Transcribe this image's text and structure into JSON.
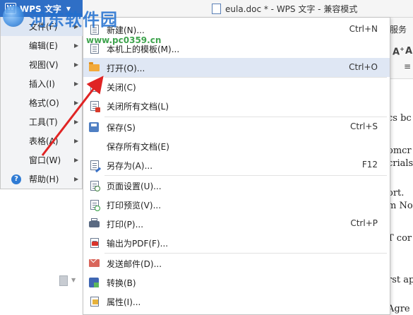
{
  "titlebar": {
    "app_name": "WPS 文字",
    "logo_glyph": "W",
    "doc_title": "eula.doc * - WPS 文字 - 兼容模式"
  },
  "ribbon": {
    "visible_tab": "服务",
    "glyph_a": "A",
    "glyph_b": "A"
  },
  "document": {
    "lines": [
      "cs bc",
      "omcr",
      "crials",
      "ort.",
      "m No",
      "T cor",
      "rst app",
      "Agre"
    ]
  },
  "main_menu": {
    "items": [
      {
        "label": "文件(F)",
        "has_submenu": true,
        "active": true
      },
      {
        "label": "编辑(E)",
        "has_submenu": true
      },
      {
        "label": "视图(V)",
        "has_submenu": true
      },
      {
        "label": "插入(I)",
        "has_submenu": true
      },
      {
        "label": "格式(O)",
        "has_submenu": true
      },
      {
        "label": "工具(T)",
        "has_submenu": true
      },
      {
        "label": "表格(A)",
        "has_submenu": true
      },
      {
        "label": "窗口(W)",
        "has_submenu": true
      },
      {
        "label": "帮助(H)",
        "has_submenu": true,
        "icon": "help-icon"
      }
    ],
    "help_glyph": "?"
  },
  "file_menu": {
    "items": [
      {
        "label": "新建(N)...",
        "shortcut": "Ctrl+N",
        "icon": "new-document-icon"
      },
      {
        "label": "本机上的模板(M)...",
        "shortcut": "",
        "icon": "template-icon"
      },
      {
        "label": "打开(O)...",
        "shortcut": "Ctrl+O",
        "icon": "folder-open-icon",
        "highlighted": true
      },
      {
        "label": "关闭(C)",
        "shortcut": "",
        "icon": "close-document-icon"
      },
      {
        "label": "关闭所有文档(L)",
        "shortcut": "",
        "icon": "close-all-icon"
      },
      {
        "label": "保存(S)",
        "shortcut": "Ctrl+S",
        "icon": "save-icon"
      },
      {
        "label": "保存所有文档(E)",
        "shortcut": "",
        "icon": ""
      },
      {
        "label": "另存为(A)...",
        "shortcut": "F12",
        "icon": "save-as-icon"
      },
      {
        "label": "页面设置(U)...",
        "shortcut": "",
        "icon": "page-setup-icon"
      },
      {
        "label": "打印预览(V)...",
        "shortcut": "",
        "icon": "print-preview-icon"
      },
      {
        "label": "打印(P)...",
        "shortcut": "Ctrl+P",
        "icon": "printer-icon"
      },
      {
        "label": "输出为PDF(F)...",
        "shortcut": "",
        "icon": "pdf-icon"
      },
      {
        "label": "发送邮件(D)...",
        "shortcut": "",
        "icon": "mail-icon"
      },
      {
        "label": "转换(B)",
        "shortcut": "",
        "icon": "convert-icon"
      },
      {
        "label": "属性(I)...",
        "shortcut": "",
        "icon": "properties-icon"
      }
    ]
  },
  "watermark": {
    "text": "河东软件园",
    "url": "www.pc0359.cn"
  },
  "colors": {
    "accent_blue": "#2f6fc6",
    "menu_highlight": "#dfe7f4",
    "arrow_red": "#e02424",
    "watermark_blue": "#1f6fd0",
    "watermark_green": "#2a9a3a"
  }
}
